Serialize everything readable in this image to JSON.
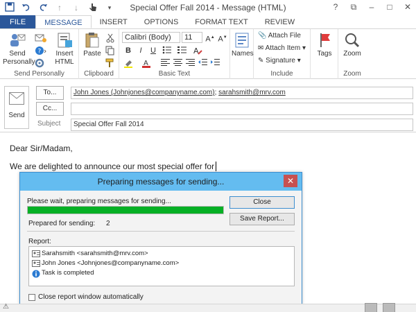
{
  "window": {
    "title": "Special Offer Fall 2014 - Message (HTML)",
    "controls": {
      "help": "?",
      "restore": "⧉",
      "minimize": "–",
      "maximize": "□",
      "close": "✕"
    }
  },
  "qat": {
    "save": "save-icon",
    "undo": "undo-icon",
    "redo": "redo-icon",
    "up": "up-arrow-icon",
    "down": "down-arrow-icon",
    "customize": "customize-icon"
  },
  "tabs": [
    "FILE",
    "MESSAGE",
    "INSERT",
    "OPTIONS",
    "FORMAT TEXT",
    "REVIEW"
  ],
  "ribbon": {
    "send_personally": {
      "label": "Send Personally",
      "group": "Send Personally"
    },
    "insert_html": {
      "label": "Insert HTML"
    },
    "clipboard": {
      "paste": "Paste",
      "group": "Clipboard"
    },
    "basic_text": {
      "font": "Calibri (Body)",
      "size": "11",
      "group": "Basic Text",
      "bold": "B",
      "italic": "I",
      "underline": "U"
    },
    "names": "Names",
    "include": {
      "attach_file": "Attach File",
      "attach_item": "Attach Item",
      "signature": "Signature",
      "group": "Include"
    },
    "tags": "Tags",
    "zoom": {
      "label": "Zoom",
      "group": "Zoom"
    }
  },
  "compose": {
    "send": "Send",
    "to_button": "To...",
    "cc_button": "Cc...",
    "subject_label": "Subject",
    "to_value": "John Jones (Johnjones@companyname.com)",
    "to_separator": "; ",
    "to_value2": "sarahsmith@mrv.com",
    "cc_value": "",
    "subject_value": "Special Offer Fall 2014"
  },
  "body": {
    "greeting": "Dear Sir/Madam,",
    "line1": "We are delighted to announce our most special offer for"
  },
  "dialog": {
    "title": "Preparing messages for sending...",
    "message": "Please wait, preparing messages for sending...",
    "progress": 1.0,
    "close": "Close",
    "save_report": "Save Report...",
    "prepared_label": "Prepared for sending:",
    "prepared_count": "2",
    "report_label": "Report:",
    "report_rows": [
      "Sarahsmith <sarahsmith@mrv.com>",
      "John Jones <Johnjones@companyname.com>",
      "Task is completed"
    ],
    "auto_close": "Close report window automatically"
  },
  "colors": {
    "file_tab": "#2b579a",
    "progress": "#06b025",
    "dialog_title": "#64bcf0",
    "close_red": "#c75050"
  }
}
